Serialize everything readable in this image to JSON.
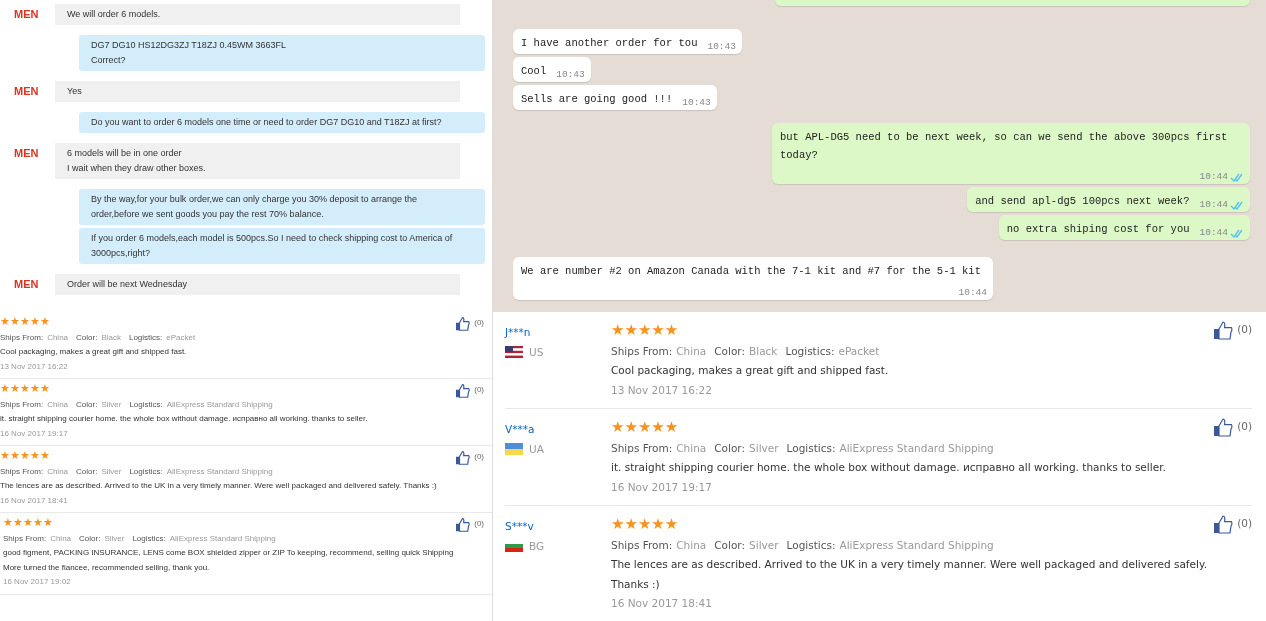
{
  "seller_chat": {
    "messages": [
      {
        "kind": "incoming",
        "avatar": "MEN",
        "text": "We will order 6 models."
      },
      {
        "kind": "outgoing",
        "text": "DG7 DG10 HS12DG3ZJ T18ZJ 0.45WM 3663FL\nCorrect?"
      },
      {
        "kind": "incoming",
        "avatar": "MEN",
        "text": "Yes"
      },
      {
        "kind": "outgoing",
        "text": "Do you want to order 6 models one time or need to order DG7 DG10 and T18ZJ at first?"
      },
      {
        "kind": "incoming",
        "avatar": "MEN",
        "text": "6 models will be in one order\nI wait when they draw other boxes."
      },
      {
        "kind": "outgoing",
        "text": "By the way,for your bulk order,we can only charge you 30% deposit to arrange the\norder,before we sent goods you pay the rest 70% balance."
      },
      {
        "kind": "outgoing",
        "text": "If you order 6 models,each model is 500pcs.So I need to check shipping cost to America of\n3000pcs,right?"
      },
      {
        "kind": "incoming",
        "avatar": "MEN",
        "text": "Order will be next Wednesday"
      }
    ]
  },
  "messenger_chat": {
    "messages": [
      {
        "kind": "sent"
      },
      {
        "kind": "received",
        "text": "I have another order for tou",
        "time": "10:43"
      },
      {
        "kind": "received",
        "text": "Cool",
        "time": "10:43"
      },
      {
        "kind": "received",
        "text": "Sells are going good !!!",
        "time": "10:43"
      },
      {
        "kind": "sent",
        "text": "but APL-DG5 need to be next week, so can we send the above 300pcs first today?",
        "time": "10:44",
        "read": true
      },
      {
        "kind": "sent",
        "text": "and send apl-dg5 100pcs next week?",
        "time": "10:44",
        "read": true
      },
      {
        "kind": "sent",
        "text": "no extra shiping cost for you",
        "time": "10:44",
        "read": true
      },
      {
        "kind": "received",
        "text": "We are number #2 on Amazon Canada with the 7-1 kit and #7 for the 5-1 kit",
        "time": "10:44"
      }
    ]
  },
  "reviews_small": [
    {
      "stars": 5,
      "ships_from_label": "Ships From:",
      "ships_from": "China",
      "color_label": "Color:",
      "variant": "Black",
      "logistics_label": "Logistics:",
      "logistics": "ePacket",
      "text": "Cool packaging, makes a great gift and shipped fast.",
      "date": "13 Nov 2017 16:22",
      "likes": "(0)"
    },
    {
      "stars": 5,
      "ships_from_label": "Ships From:",
      "ships_from": "China",
      "color_label": "Color:",
      "variant": "Silver",
      "logistics_label": "Logistics:",
      "logistics": "AliExpress Standard Shipping",
      "text": "it. straight shipping courier home. the whole box without damage. исправно all working. thanks to seller.",
      "date": "16 Nov 2017 19:17",
      "likes": "(0)"
    },
    {
      "stars": 5,
      "ships_from_label": "Ships From:",
      "ships_from": "China",
      "color_label": "Color:",
      "variant": "Silver",
      "logistics_label": "Logistics:",
      "logistics": "AliExpress Standard Shipping",
      "text": "The lences are as described. Arrived to the UK in a very timely manner. Were well packaged and delivered safely. Thanks :)",
      "date": "16 Nov 2017 18:41",
      "likes": "(0)"
    },
    {
      "stars": 5,
      "ships_from_label": "Ships From:",
      "ships_from": "China",
      "color_label": "Color:",
      "variant": "Silver",
      "logistics_label": "Logistics:",
      "logistics": "AliExpress Standard Shipping",
      "text": "good figment, PACKING INSURANCE, LENS come BOX shielded zipper or ZIP To keeping, recommend, selling quick Shipping\nMore turned the fiancee, recommended selling, thank you.",
      "date": "16 Nov 2017 19:02",
      "likes": "(0)"
    }
  ],
  "reviews_large": [
    {
      "user": "J***n",
      "flag": {
        "kind": "us"
      },
      "country": "US",
      "stars": 5,
      "ships_from_label": "Ships From:",
      "ships_from": "China",
      "color_label": "Color:",
      "variant": "Black",
      "logistics_label": "Logistics:",
      "logistics": "ePacket",
      "text": "Cool packaging, makes a great gift and shipped fast.",
      "date": "13 Nov 2017 16:22",
      "likes": "(0)"
    },
    {
      "user": "V***a",
      "flag": {
        "kind": "ua"
      },
      "country": "UA",
      "stars": 5,
      "ships_from_label": "Ships From:",
      "ships_from": "China",
      "color_label": "Color:",
      "variant": "Silver",
      "logistics_label": "Logistics:",
      "logistics": "AliExpress Standard Shipping",
      "text": "it. straight shipping courier home. the whole box without damage. исправно all working. thanks to seller.",
      "date": "16 Nov 2017 19:17",
      "likes": "(0)"
    },
    {
      "user": "S***v",
      "flag": {
        "kind": "bg"
      },
      "country": "BG",
      "stars": 5,
      "ships_from_label": "Ships From:",
      "ships_from": "China",
      "color_label": "Color:",
      "variant": "Silver",
      "logistics_label": "Logistics:",
      "logistics": "AliExpress Standard Shipping",
      "text": "The lences are as described. Arrived to the UK in a very timely manner. Were well packaged and delivered safely. Thanks :)",
      "date": "16 Nov 2017 18:41",
      "likes": "(0)"
    }
  ]
}
